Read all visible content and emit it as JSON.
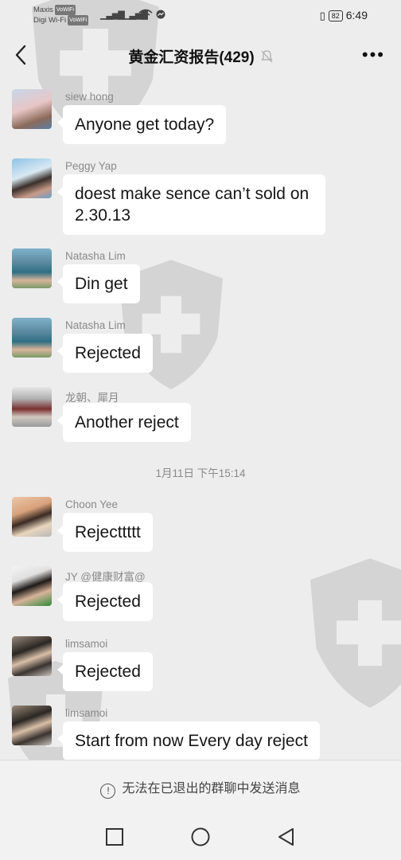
{
  "status_bar": {
    "carrier1": "Maxis",
    "carrier2": "Digi Wi-Fi",
    "volte_tag": "VoWiFi",
    "battery": "82",
    "time": "6:49"
  },
  "header": {
    "title": "黄金汇资报告(429)",
    "more_label": "•••"
  },
  "messages": [
    {
      "sender": "siew hong",
      "text": "Anyone get today?"
    },
    {
      "sender": "Peggy Yap",
      "text": "doest make sence can’t sold on 2.30.13"
    },
    {
      "sender": "Natasha Lim",
      "text": "Din get"
    },
    {
      "sender": "Natasha Lim",
      "text": "Rejected"
    },
    {
      "sender": "龙朝、犀月",
      "text": "Another reject"
    },
    {
      "sender": "Choon Yee",
      "text": "Rejecttttt"
    },
    {
      "sender": "JY @健康财富@",
      "text": "Rejected"
    },
    {
      "sender": "limsamoi",
      "text": "Rejected"
    },
    {
      "sender": "limsamoi",
      "text": "Start from now Every day reject"
    }
  ],
  "timestamp": "1月11日 下午15:14",
  "footer": {
    "notice": "无法在已退出的群聊中发送消息",
    "info_glyph": "!"
  },
  "colors": {
    "background": "#ededed",
    "bubble": "#ffffff",
    "sender_text": "#8a8a8a"
  }
}
